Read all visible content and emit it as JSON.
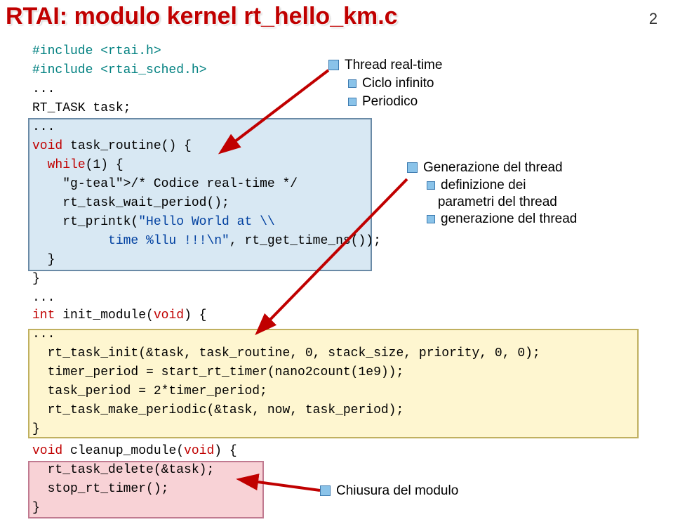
{
  "page": {
    "title": "RTAI: modulo kernel rt_hello_km.c",
    "number": "2"
  },
  "code1": "#include <rtai.h>\n#include <rtai_sched.h>\n...\nRT_TASK task;\n...\nvoid task_routine() {\n  while(1) {\n    /* Codice real-time */\n    rt_task_wait_period();\n    rt_printk(\"Hello World at \\\\\n          time %llu !!!\\n\", rt_get_time_ns());\n  }\n}\n...",
  "code2": "int init_module(void) {\n...\n  rt_task_init(&task, task_routine, 0, stack_size, priority, 0, 0);\n  timer_period = start_rt_timer(nano2count(1e9));\n  task_period = 2*timer_period;\n  rt_task_make_periodic(&task, now, task_period);\n}",
  "code3": "void cleanup_module(void) {\n  rt_task_delete(&task);\n  stop_rt_timer();\n}",
  "bullets": {
    "thread_rt": "Thread real-time",
    "ciclo": "Ciclo infinito",
    "periodico": "Periodico",
    "gen_thread": "Generazione del thread",
    "definizione": "definizione dei parametri del thread",
    "generazione": "generazione del thread",
    "chiusura": "Chiusura del modulo"
  }
}
